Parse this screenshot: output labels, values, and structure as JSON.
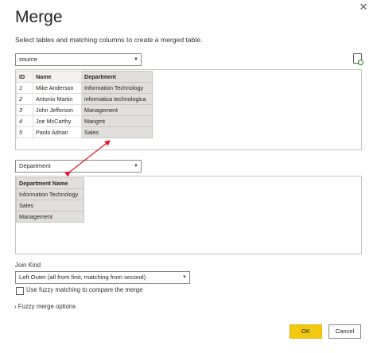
{
  "dialog": {
    "title": "Merge",
    "close_glyph": "✕",
    "subtitle": "Select tables and matching columns to create a merged table."
  },
  "first_table": {
    "selected": "source",
    "headers": [
      "ID",
      "Name",
      "Department"
    ],
    "rows": [
      [
        "1",
        "Mike Anderson",
        "Information Technology"
      ],
      [
        "2",
        "Antonio Martin",
        "informatica technologica"
      ],
      [
        "3",
        "John Jefferson",
        "Management"
      ],
      [
        "4",
        "Joe McCarthy",
        "Mangmt"
      ],
      [
        "5",
        "Paolo Adrian",
        "Sales"
      ]
    ]
  },
  "second_table": {
    "selected": "Department",
    "headers": [
      "Department Name"
    ],
    "rows": [
      [
        "Information Technology"
      ],
      [
        "Sales"
      ],
      [
        "Management"
      ]
    ]
  },
  "join": {
    "label": "Join Kind",
    "selected": "Left Outer (all from first, matching from second)"
  },
  "fuzzy": {
    "checkbox_label": "Use fuzzy matching to compare the merge",
    "options_label": "Fuzzy merge options",
    "expander_glyph": "›"
  },
  "buttons": {
    "ok": "OK",
    "cancel": "Cancel"
  },
  "colors": {
    "ok_button": "#f2c811",
    "arrow": "#e81123",
    "selected_column": "#e1dfdd"
  },
  "icons": {
    "dropdown": "chevron-down-icon",
    "preview": "file-refresh-icon"
  }
}
